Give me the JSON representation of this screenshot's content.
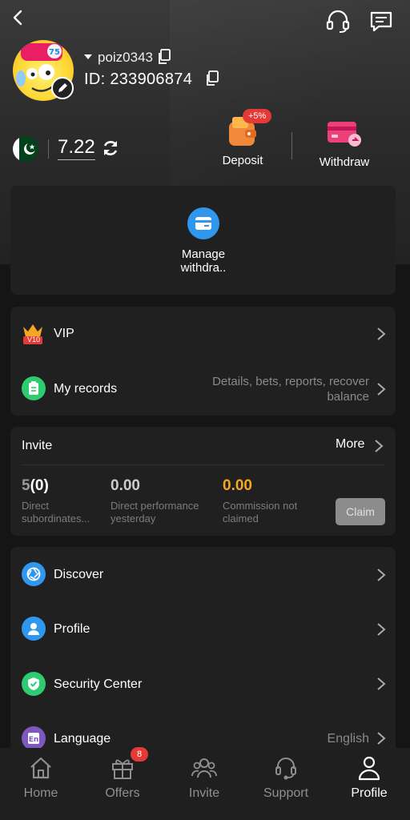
{
  "header": {
    "back_icon": "chevron-left-icon",
    "support_icon": "headset-icon",
    "message_icon": "message-icon"
  },
  "user": {
    "username": "poiz0343",
    "id_label": "ID: 233906874",
    "edit_icon": "edit-pencil-icon"
  },
  "wallet": {
    "flag": "pakistan-flag",
    "balance": "7.22"
  },
  "actions": {
    "deposit_label": "Deposit",
    "deposit_bonus": "+5%",
    "withdraw_label": "Withdraw"
  },
  "manage": {
    "label": "Manage withdra..",
    "icon": "card-icon"
  },
  "menu1": {
    "vip_label": "VIP",
    "vip_badge": "V10",
    "records_label": "My records",
    "records_hint": "Details, bets, reports, recover balance"
  },
  "invite": {
    "title": "Invite",
    "more": "More",
    "direct_count_a": "5",
    "direct_count_b": "(0)",
    "direct_label": "Direct subordinates...",
    "performance_value": "0.00",
    "performance_label": "Direct performance yesterday",
    "commission_value": "0.00",
    "commission_label": "Commission not claimed",
    "claim": "Claim"
  },
  "menu2": {
    "discover": "Discover",
    "profile": "Profile",
    "security": "Security Center",
    "language": "Language",
    "language_value": "English"
  },
  "nav": {
    "home": "Home",
    "offers": "Offers",
    "offers_badge": "8",
    "invite": "Invite",
    "support": "Support",
    "profile": "Profile",
    "active": "Profile"
  },
  "colors": {
    "accent_blue": "#2f97ee",
    "gold": "#f5a623",
    "green": "#2ecc71",
    "red": "#e53935"
  }
}
